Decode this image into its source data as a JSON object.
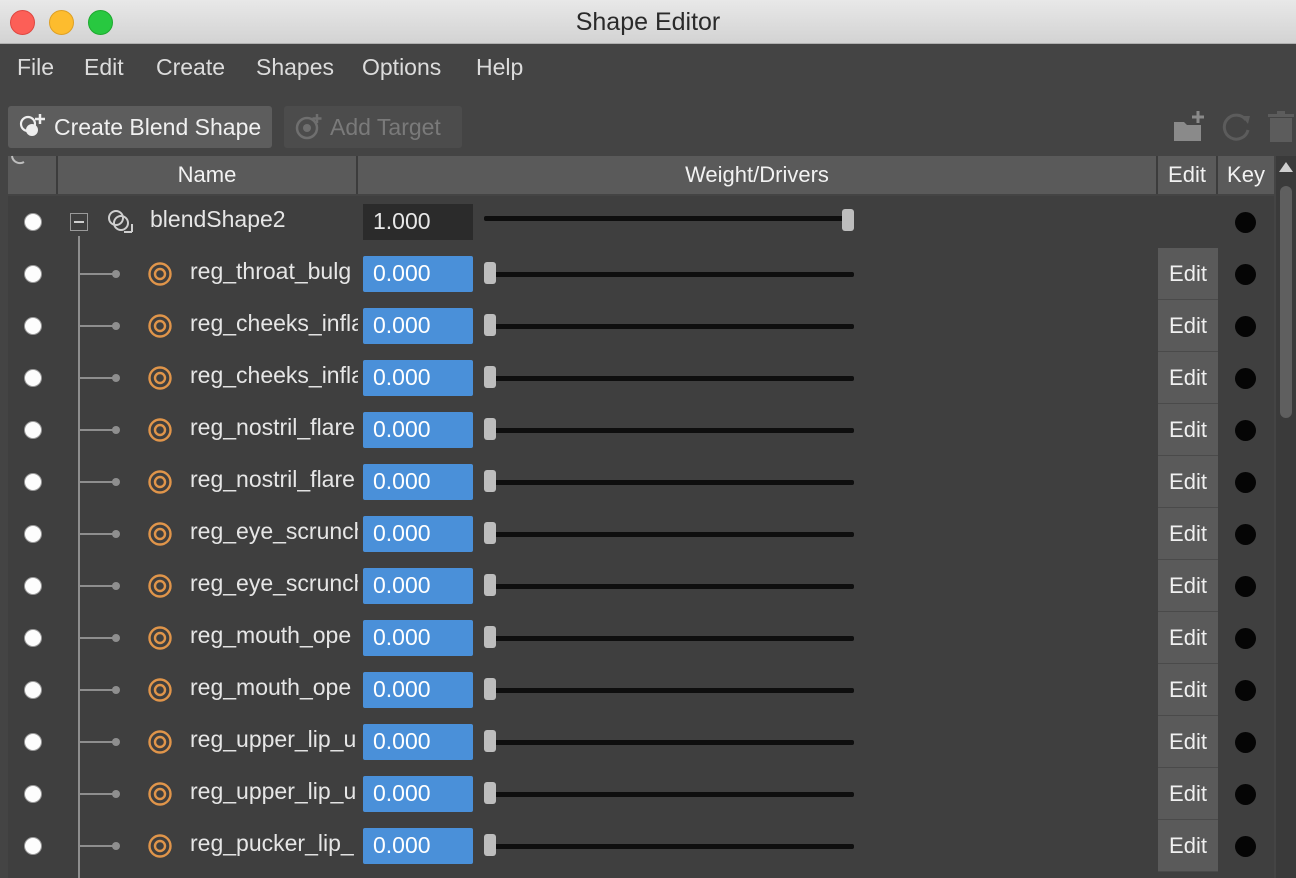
{
  "window": {
    "title": "Shape Editor"
  },
  "menu": [
    "File",
    "Edit",
    "Create",
    "Shapes",
    "Options",
    "Help"
  ],
  "toolbar": {
    "create_blend_shape": "Create Blend Shape",
    "add_target": "Add Target",
    "right_icons": [
      "new-folder-icon",
      "refresh-icon",
      "trash-icon"
    ]
  },
  "columns": {
    "name": "Name",
    "weight": "Weight/Drivers",
    "edit": "Edit",
    "key": "Key"
  },
  "group": {
    "name": "blendShape2",
    "weight": "1.000",
    "slider_fraction": 1.0
  },
  "targets": [
    {
      "name": "reg_throat_bulg",
      "weight": "0.000",
      "edit": "Edit",
      "slider_fraction": 0
    },
    {
      "name": "reg_cheeks_infla",
      "weight": "0.000",
      "edit": "Edit",
      "slider_fraction": 0
    },
    {
      "name": "reg_cheeks_infla",
      "weight": "0.000",
      "edit": "Edit",
      "slider_fraction": 0
    },
    {
      "name": "reg_nostril_flare",
      "weight": "0.000",
      "edit": "Edit",
      "slider_fraction": 0
    },
    {
      "name": "reg_nostril_flare",
      "weight": "0.000",
      "edit": "Edit",
      "slider_fraction": 0
    },
    {
      "name": "reg_eye_scrunch",
      "weight": "0.000",
      "edit": "Edit",
      "slider_fraction": 0
    },
    {
      "name": "reg_eye_scrunch",
      "weight": "0.000",
      "edit": "Edit",
      "slider_fraction": 0
    },
    {
      "name": "reg_mouth_ope",
      "weight": "0.000",
      "edit": "Edit",
      "slider_fraction": 0
    },
    {
      "name": "reg_mouth_ope",
      "weight": "0.000",
      "edit": "Edit",
      "slider_fraction": 0
    },
    {
      "name": "reg_upper_lip_u",
      "weight": "0.000",
      "edit": "Edit",
      "slider_fraction": 0
    },
    {
      "name": "reg_upper_lip_u",
      "weight": "0.000",
      "edit": "Edit",
      "slider_fraction": 0
    },
    {
      "name": "reg_pucker_lip_",
      "weight": "0.000",
      "edit": "Edit",
      "slider_fraction": 0
    }
  ],
  "colors": {
    "accent_blue": "#4a90d9",
    "target_icon_orange": "#e0954a",
    "background": "#444444"
  }
}
